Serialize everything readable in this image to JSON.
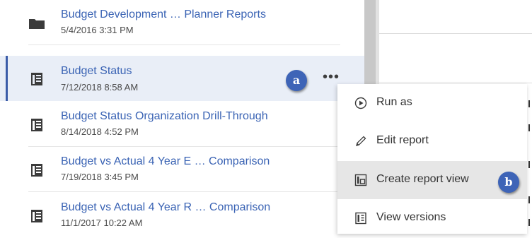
{
  "items": [
    {
      "title": "Budget Development … Planner Reports",
      "date": "5/4/2016 3:31 PM",
      "icon": "folder-icon"
    },
    {
      "title": "Budget Status",
      "date": "7/12/2018 8:58 AM",
      "icon": "report-icon",
      "selected": true
    },
    {
      "title": "Budget Status Organization Drill-Through",
      "date": "8/14/2018 4:52 PM",
      "icon": "report-icon"
    },
    {
      "title": "Budget vs Actual 4 Year E … Comparison",
      "date": "7/19/2018 3:45 PM",
      "icon": "report-icon"
    },
    {
      "title": "Budget vs Actual 4 Year R … Comparison",
      "date": "11/1/2017 10:22 AM",
      "icon": "report-icon"
    }
  ],
  "more_button": "•••",
  "context_menu": {
    "items": [
      {
        "label": "Run as",
        "icon": "play-circle-icon"
      },
      {
        "label": "Edit report",
        "icon": "pencil-icon"
      },
      {
        "label": "Create report view",
        "icon": "report-view-icon",
        "hovered": true
      },
      {
        "label": "View versions",
        "icon": "versions-icon"
      }
    ]
  },
  "callouts": {
    "a": "a",
    "b": "b"
  },
  "colors": {
    "accent": "#3e64b7",
    "link": "#3a63b4",
    "selected_bg": "#e9eef7",
    "menu_hover": "#e6e6e6"
  }
}
